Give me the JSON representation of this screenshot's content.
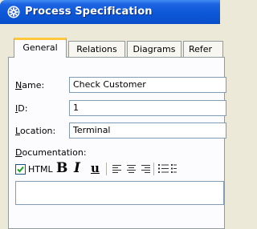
{
  "window": {
    "title": "Process Specification",
    "icon": "settings-gear-icon"
  },
  "tabs": [
    {
      "label": "General",
      "active": true
    },
    {
      "label": "Relations",
      "active": false
    },
    {
      "label": "Diagrams",
      "active": false
    },
    {
      "label": "Refer",
      "active": false
    }
  ],
  "form": {
    "name_label_mnemonic": "N",
    "name_label_rest": "ame:",
    "name_value": "Check Customer",
    "id_label_mnemonic": "I",
    "id_label_rest": "D:",
    "id_value": "1",
    "location_label_mnemonic": "L",
    "location_label_rest": "ocation:",
    "location_value": "Terminal",
    "documentation_label_mnemonic": "D",
    "documentation_label_rest": "ocumentation:"
  },
  "toolbar": {
    "html_label": "HTML",
    "html_checked": true,
    "bold": "B",
    "italic": "I",
    "underline": "u"
  },
  "colors": {
    "titlebar": "#0c58d8",
    "active_tab_accent": "#ffc83c"
  }
}
